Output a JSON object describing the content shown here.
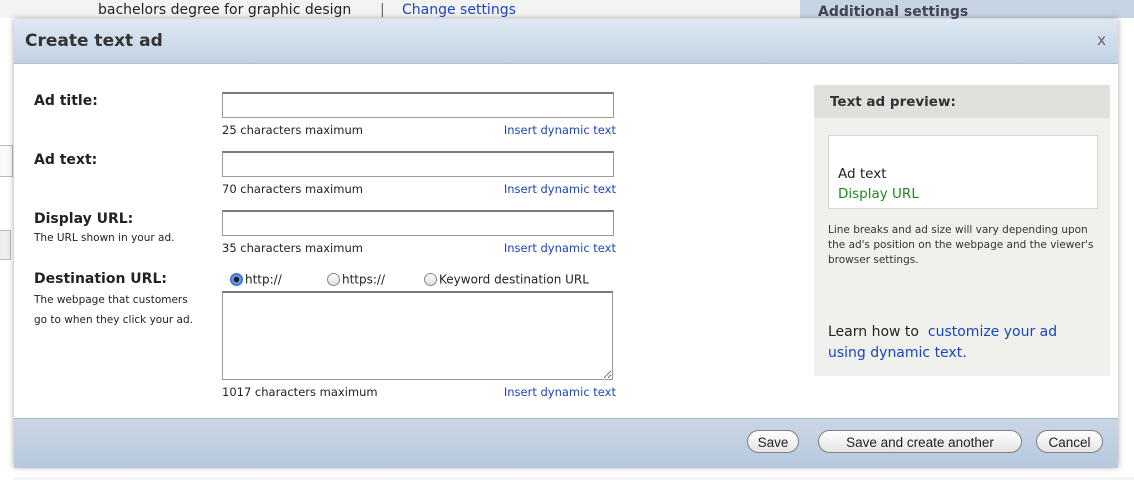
{
  "background": {
    "top_text": "bachelors degree for graphic design",
    "top_separator": "|",
    "top_link": "Change settings",
    "right_panel_title": "Additional settings"
  },
  "dialog": {
    "title": "Create text ad",
    "close_label": "x"
  },
  "fields": {
    "ad_title": {
      "label": "Ad title:",
      "value": "",
      "counter": "25 characters maximum",
      "dynamic_link": "Insert dynamic text"
    },
    "ad_text": {
      "label": "Ad text:",
      "value": "",
      "counter": "70 characters maximum",
      "dynamic_link": "Insert dynamic text"
    },
    "display_url": {
      "label": "Display URL:",
      "help": "The URL shown in your ad.",
      "value": "",
      "counter": "35 characters maximum",
      "dynamic_link": "Insert dynamic text"
    },
    "destination_url": {
      "label": "Destination URL:",
      "help_line1": "The webpage that customers",
      "help_line2": "go to when they click your ad.",
      "value": "",
      "counter": "1017 characters maximum",
      "dynamic_link": "Insert dynamic text",
      "options": [
        {
          "label": "http://",
          "selected": true
        },
        {
          "label": "https://",
          "selected": false
        },
        {
          "label": "Keyword destination URL",
          "selected": false
        }
      ]
    }
  },
  "preview": {
    "title": "Text ad preview:",
    "ad_text": "Ad text",
    "display_url": "Display URL",
    "note": "Line breaks and ad size will vary depending upon the ad's position on the webpage and the viewer's browser settings.",
    "learn_prefix": "Learn how to",
    "learn_link": "customize your ad using dynamic text."
  },
  "buttons": {
    "save": "Save",
    "save_another": "Save and create another",
    "cancel": "Cancel"
  },
  "colors": {
    "header_bg": "#c1d1e5",
    "link": "#1a44c2",
    "url_green": "#1d8a1d"
  }
}
